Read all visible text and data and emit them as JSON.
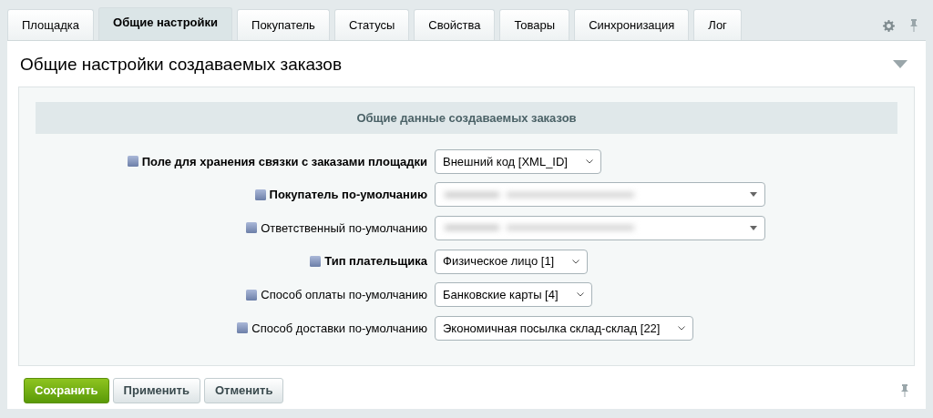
{
  "tabs": [
    {
      "label": "Площадка",
      "selected": false
    },
    {
      "label": "Общие настройки",
      "selected": true
    },
    {
      "label": "Покупатель",
      "selected": false
    },
    {
      "label": "Статусы",
      "selected": false
    },
    {
      "label": "Свойства",
      "selected": false
    },
    {
      "label": "Товары",
      "selected": false
    },
    {
      "label": "Синхронизация",
      "selected": false
    },
    {
      "label": "Лог",
      "selected": false
    }
  ],
  "panel": {
    "title": "Общие настройки создаваемых заказов",
    "expanded": true
  },
  "section": {
    "title": "Общие данные создаваемых заказов"
  },
  "fields": [
    {
      "label": "Поле для хранения связки с заказами площадки",
      "bold": true,
      "kind": "select",
      "value": "Внешний код [XML_ID]"
    },
    {
      "label": "Покупатель по-умолчанию",
      "bold": true,
      "kind": "redacted"
    },
    {
      "label": "Ответственный по-умолчанию",
      "bold": false,
      "kind": "redacted"
    },
    {
      "label": "Тип плательщика",
      "bold": true,
      "kind": "select",
      "value": "Физическое лицо [1]"
    },
    {
      "label": "Способ оплаты по-умолчанию",
      "bold": false,
      "kind": "select",
      "value": "Банковские карты [4]"
    },
    {
      "label": "Способ доставки по-умолчанию",
      "bold": false,
      "kind": "select",
      "value": "Экономичная посылка склад-склад [22]"
    }
  ],
  "buttons": [
    {
      "label": "Сохранить",
      "kind": "primary"
    },
    {
      "label": "Применить",
      "kind": "secondary"
    },
    {
      "label": "Отменить",
      "kind": "secondary"
    }
  ]
}
